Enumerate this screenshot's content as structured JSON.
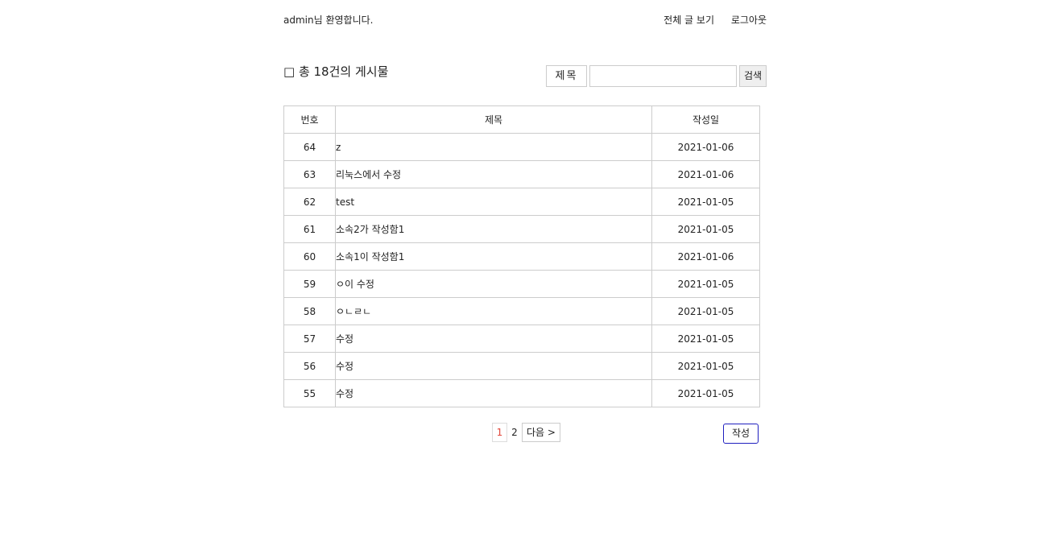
{
  "header": {
    "welcome": "admin님 환영합니다.",
    "view_all": "전체 글 보기",
    "logout": "로그아웃"
  },
  "board": {
    "heading": "□ 총 18건의 게시물",
    "columns": [
      "번호",
      "제목",
      "작성일"
    ],
    "rows": [
      {
        "no": "64",
        "title": "z",
        "date": "2021-01-06"
      },
      {
        "no": "63",
        "title": "리눅스에서 수정",
        "date": "2021-01-06"
      },
      {
        "no": "62",
        "title": "test",
        "date": "2021-01-05"
      },
      {
        "no": "61",
        "title": "소속2가 작성함1",
        "date": "2021-01-05"
      },
      {
        "no": "60",
        "title": "소속1이 작성함1",
        "date": "2021-01-06"
      },
      {
        "no": "59",
        "title": "ㅇ이 수정",
        "date": "2021-01-05"
      },
      {
        "no": "58",
        "title": "ㅇㄴㄹㄴ",
        "date": "2021-01-05"
      },
      {
        "no": "57",
        "title": "수정",
        "date": "2021-01-05"
      },
      {
        "no": "56",
        "title": "수정",
        "date": "2021-01-05"
      },
      {
        "no": "55",
        "title": "수정",
        "date": "2021-01-05"
      }
    ]
  },
  "search": {
    "field": "제목",
    "value": "",
    "button": "검색"
  },
  "pagination": {
    "current": "1",
    "pages": [
      "2"
    ],
    "next": "다음 >"
  },
  "actions": {
    "write": "작성"
  },
  "colors": {
    "current_page": "#e2473a",
    "write_border": "#1f1fbf",
    "border": "#cccccc"
  }
}
